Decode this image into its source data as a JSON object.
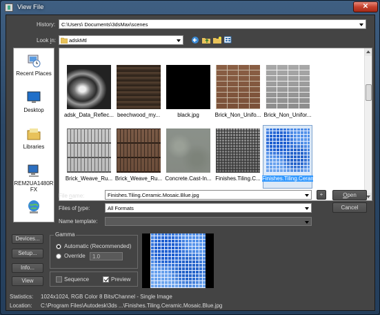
{
  "window": {
    "title": "View File",
    "close_glyph": "✕"
  },
  "history": {
    "label": "History:",
    "value": "C:\\Users\\          Documents\\3dsMax\\scenes"
  },
  "look_in": {
    "label": "Look in:",
    "value": "adskMtl"
  },
  "places": [
    {
      "label": "Recent Places",
      "icon": "recent-places-icon"
    },
    {
      "label": "Desktop",
      "icon": "desktop-icon"
    },
    {
      "label": "Libraries",
      "icon": "libraries-icon"
    },
    {
      "label": "REM2UA1480RFX",
      "icon": "computer-icon"
    },
    {
      "label": "",
      "icon": "network-icon"
    }
  ],
  "files": [
    {
      "name": "adsk_Data_Reflec...",
      "texture": "reflect"
    },
    {
      "name": "beechwood_my...",
      "texture": "beech"
    },
    {
      "name": "black.jpg",
      "texture": "black"
    },
    {
      "name": "Brick_Non_Unifo...",
      "texture": "brick"
    },
    {
      "name": "Brick_Non_Unifor...",
      "texture": "brickgray"
    },
    {
      "name": "Brick_Weave_Ru...",
      "texture": "weavegray"
    },
    {
      "name": "Brick_Weave_Ru...",
      "texture": "weavebrown"
    },
    {
      "name": "Concrete.Cast-In...",
      "texture": "concrete"
    },
    {
      "name": "Finishes.Tiling.C...",
      "texture": "tilegray"
    },
    {
      "name": "Finishes.Tiling.Ceramic.Mosaic.Blue.j",
      "texture": "mosaic",
      "selected": true
    }
  ],
  "form": {
    "file_name_label": "File name:",
    "file_name_value": "Finishes.Tiling.Ceramic.Mosaic.Blue.jpg",
    "files_of_type_label": "Files of type:",
    "files_of_type_value": "All Formats",
    "name_template_label": "Name template:",
    "name_template_value": "",
    "plus_label": "+",
    "open_label": "Open",
    "cancel_label": "Cancel"
  },
  "side_buttons": {
    "devices": "Devices...",
    "setup": "Setup...",
    "info": "Info...",
    "view": "View"
  },
  "gamma": {
    "title": "Gamma",
    "automatic": "Automatic (Recommended)",
    "override": "Override",
    "override_value": "1.0",
    "selected": "automatic"
  },
  "options": {
    "sequence": "Sequence",
    "sequence_checked": false,
    "preview": "Preview",
    "preview_checked": true
  },
  "statistics": {
    "label": "Statistics:",
    "value": "1024x1024, RGB Color 8 Bits/Channel - Single Image"
  },
  "location": {
    "label": "Location:",
    "value": "C:\\Program Files\\Autodesk\\3ds ...\\Finishes.Tiling.Ceramic.Mosaic.Blue.jpg"
  },
  "colors": {
    "accent_selected": "#3399ff",
    "client_bg": "#444444",
    "title_bar": "#2b4766",
    "close_button": "#c5412d"
  }
}
